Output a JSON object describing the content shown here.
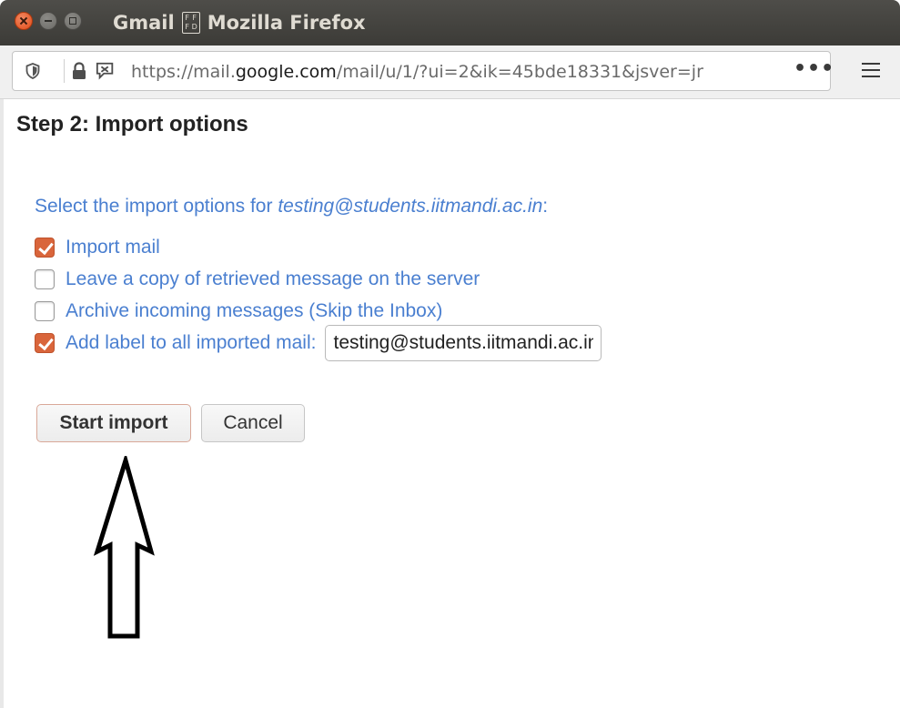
{
  "window": {
    "app": "Gmail",
    "glyph": [
      "F",
      "F",
      "F",
      "D"
    ],
    "browser": "Mozilla Firefox"
  },
  "navbar": {
    "url_prefix": "https://mail.",
    "url_domain": "google.com",
    "url_suffix": "/mail/u/1/?ui=2&ik=45bde18331&jsver=jr",
    "more_label": "•••"
  },
  "dialog": {
    "title": "Step 2: Import options",
    "prompt_prefix": "Select the import options for ",
    "prompt_email": "testing@students.iitmandi.ac.in",
    "prompt_suffix": ":",
    "options": [
      {
        "label": "Import mail",
        "checked": true
      },
      {
        "label": "Leave a copy of retrieved message on the server",
        "checked": false
      },
      {
        "label": "Archive incoming messages (Skip the Inbox)",
        "checked": false
      },
      {
        "label": "Add label to all imported mail:",
        "checked": true
      }
    ],
    "label_value": "testing@students.iitmandi.ac.in",
    "start_label": "Start import",
    "cancel_label": "Cancel"
  },
  "colors": {
    "accent_checkbox": "#d9653b",
    "link_text": "#4a7fd0",
    "titlebar": "#3c3b37"
  },
  "icons": [
    "close-window-icon",
    "minimize-window-icon",
    "maximize-window-icon",
    "shield-icon",
    "lock-icon",
    "permissions-icon",
    "more-actions-icon",
    "hamburger-menu-icon",
    "up-arrow-annotation-icon"
  ]
}
